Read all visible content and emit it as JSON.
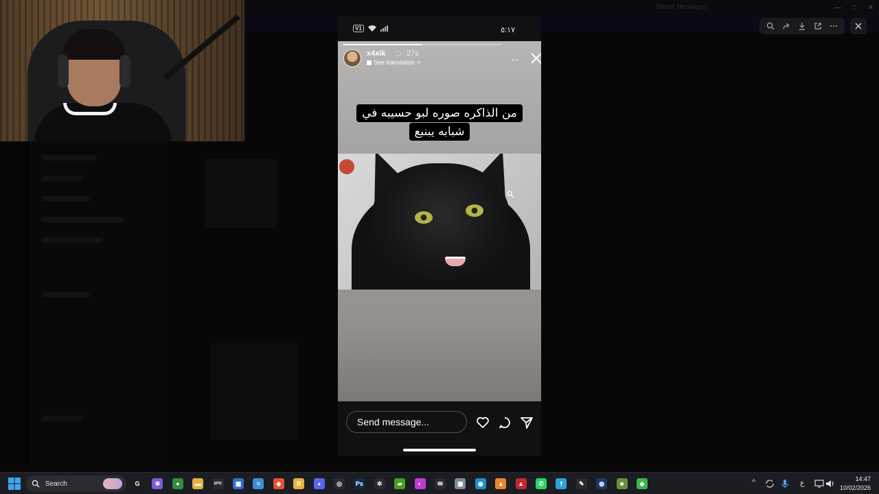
{
  "background_app": {
    "window_title": "Direct Messages"
  },
  "story": {
    "username": "x4xik",
    "time_ago": "27s",
    "translation_label": "See translation",
    "translation_chevron": ">",
    "more_label": "···",
    "caption": "من الذاكره صوره لبو حسيبه في شبابه يبنبع",
    "progress_fraction": 0.5
  },
  "phone_status": {
    "sim_label": "V1",
    "time": "٥:١٧"
  },
  "reply": {
    "placeholder": "Send message...",
    "icons": [
      "heart-icon",
      "comment-icon",
      "send-icon"
    ]
  },
  "viewer_toolbar": {
    "buttons": [
      "zoom-in-icon",
      "share-icon",
      "download-icon",
      "open-external-icon",
      "more-icon"
    ],
    "close": "close-icon"
  },
  "taskbar": {
    "search_label": "Search",
    "apps": [
      {
        "name": "copilot",
        "glyph": "G",
        "color": "#1b1d22"
      },
      {
        "name": "app-hub",
        "glyph": "✻",
        "color": "#7b5cd6"
      },
      {
        "name": "chrome",
        "glyph": "●",
        "color": "#2f8f3a"
      },
      {
        "name": "file-explorer",
        "glyph": "▬",
        "color": "#e2b33b"
      },
      {
        "name": "epic-games",
        "glyph": "EPIC",
        "color": "#2b2b2b"
      },
      {
        "name": "store",
        "glyph": "▦",
        "color": "#2f6fd3"
      },
      {
        "name": "notes",
        "glyph": "≡",
        "color": "#3b8fd8"
      },
      {
        "name": "brave",
        "glyph": "◆",
        "color": "#e5532b"
      },
      {
        "name": "rockstar",
        "glyph": "R",
        "color": "#e9b23a"
      },
      {
        "name": "discord",
        "glyph": "◕",
        "color": "#5865f2"
      },
      {
        "name": "obs",
        "glyph": "◎",
        "color": "#2b2b2b"
      },
      {
        "name": "photoshop",
        "glyph": "Ps",
        "color": "#0f2a4e"
      },
      {
        "name": "steelseries",
        "glyph": "✲",
        "color": "#2b2b2b"
      },
      {
        "name": "nvidia",
        "glyph": "▰",
        "color": "#4c9a1e"
      },
      {
        "name": "feather",
        "glyph": "◐",
        "color": "#c23ad6"
      },
      {
        "name": "mail",
        "glyph": "✉",
        "color": "#2b2b2b"
      },
      {
        "name": "gallery",
        "glyph": "▣",
        "color": "#7c8a99"
      },
      {
        "name": "edge",
        "glyph": "◉",
        "color": "#1f8fce"
      },
      {
        "name": "vlc",
        "glyph": "▲",
        "color": "#e8862a"
      },
      {
        "name": "autodesk",
        "glyph": "▲",
        "color": "#c5262b"
      },
      {
        "name": "whatsapp",
        "glyph": "✆",
        "color": "#25d366"
      },
      {
        "name": "flashcards",
        "glyph": "f",
        "color": "#2aa3d6"
      },
      {
        "name": "tool",
        "glyph": "✎",
        "color": "#2b2b2b"
      },
      {
        "name": "steam",
        "glyph": "◍",
        "color": "#1b3a66"
      },
      {
        "name": "minecraft",
        "glyph": "■",
        "color": "#6b8e3a"
      },
      {
        "name": "cube",
        "glyph": "◆",
        "color": "#3ab54a"
      }
    ],
    "tray": {
      "chevron": "^",
      "language": "ع",
      "time": "14:47",
      "date": "10/02/2026"
    }
  }
}
